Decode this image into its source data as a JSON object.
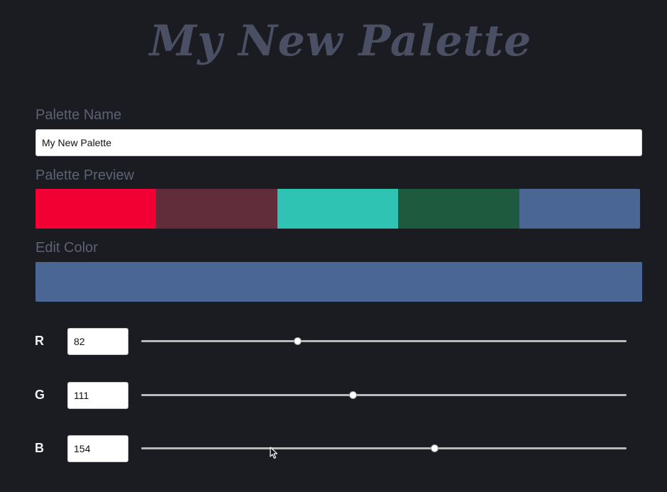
{
  "title": "My New Palette",
  "palette_name": {
    "label": "Palette Name",
    "value": "My New Palette"
  },
  "preview": {
    "label": "Palette Preview",
    "swatches": [
      "#f20034",
      "#622d3b",
      "#2fc3b4",
      "#1e5a3e",
      "#4a6695"
    ]
  },
  "edit": {
    "label": "Edit Color",
    "color": "#4a6695"
  },
  "channels": {
    "r": {
      "label": "R",
      "value": "82",
      "max": 255
    },
    "g": {
      "label": "G",
      "value": "111",
      "max": 255
    },
    "b": {
      "label": "B",
      "value": "154",
      "max": 255
    }
  },
  "colors": {
    "background": "#1b1c22",
    "title": "#4a4f63",
    "section_label": "#5d6173"
  }
}
